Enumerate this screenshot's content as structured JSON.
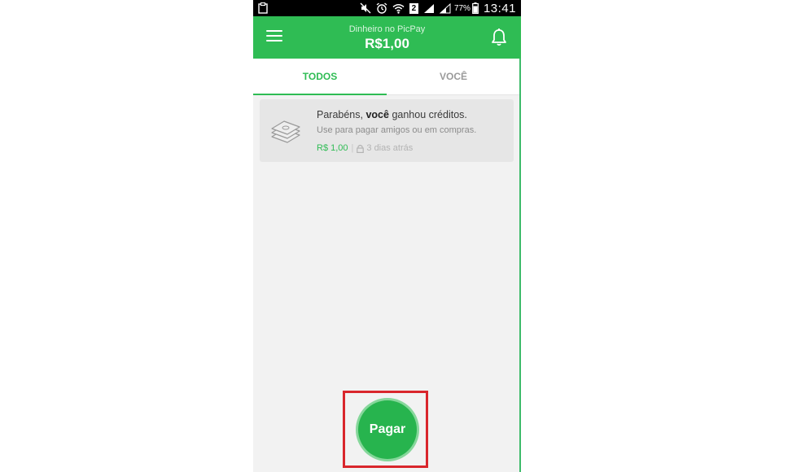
{
  "status_bar": {
    "battery_percent": "77%",
    "time": "13:41",
    "sim_number": "2"
  },
  "app_bar": {
    "balance_label": "Dinheiro no PicPay",
    "balance_value": "R$1,00"
  },
  "tabs": [
    {
      "label": "TODOS",
      "active": true
    },
    {
      "label": "VOCÊ",
      "active": false
    }
  ],
  "feed": [
    {
      "icon": "money-stack-icon",
      "title_prefix": "Parabéns, ",
      "title_bold": "você",
      "title_suffix": " ganhou créditos.",
      "subtitle": "Use para pagar amigos ou em compras.",
      "amount": "R$ 1,00",
      "separator": "|",
      "time": "3 dias atrás"
    }
  ],
  "pay_button": {
    "label": "Pagar"
  },
  "colors": {
    "brand_green": "#2fbc54",
    "highlight_red": "#d9262c"
  }
}
